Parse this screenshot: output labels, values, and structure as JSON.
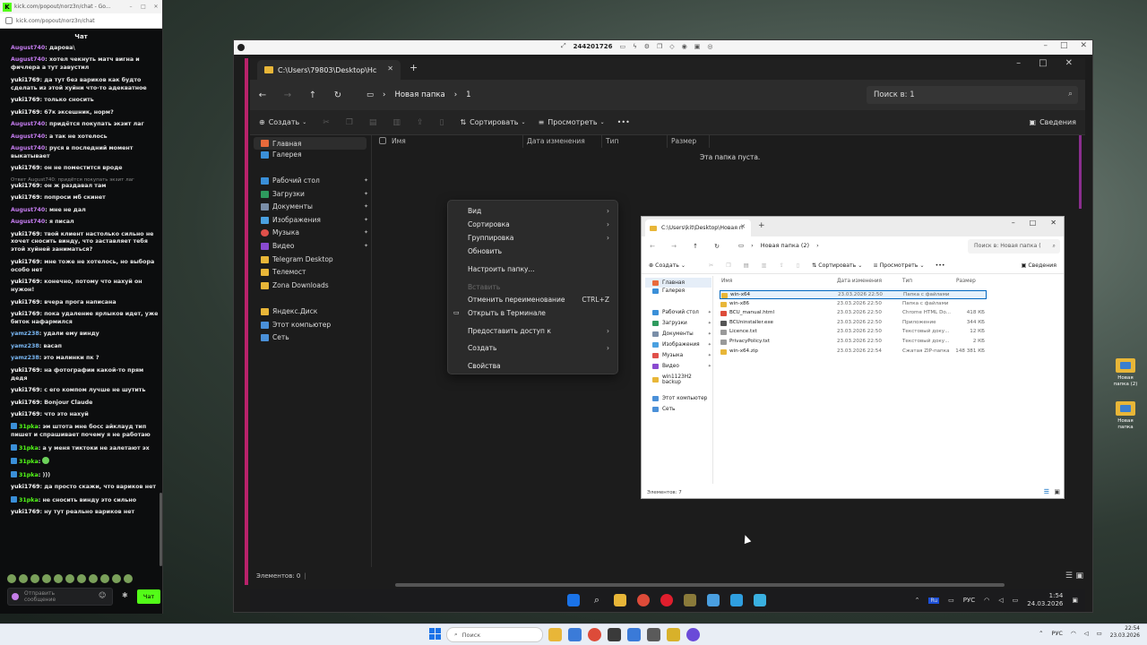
{
  "chat": {
    "window_url": "kick.com/popout/norz3n/chat - Go...",
    "address": "kick.com/popout/norz3n/chat",
    "title": "Чат",
    "messages": [
      {
        "user": "August740",
        "color": "#c77df3",
        "text": "дарова\\"
      },
      {
        "user": "August740",
        "color": "#c77df3",
        "text": "хотел чекнуть матч вигна и фичлера а тут завустил"
      },
      {
        "user": "yuki1769",
        "color": "#ffffff",
        "text": "да тут без вариков как будто сделать из этой хуйни что-то адекватное"
      },
      {
        "user": "yuki1769",
        "color": "#ffffff",
        "text": "только сносить"
      },
      {
        "user": "yuki1769",
        "color": "#ffffff",
        "text": "67к эксешник, норм?"
      },
      {
        "user": "August740",
        "color": "#c77df3",
        "text": "придётся покупать экзит лаг"
      },
      {
        "user": "August740",
        "color": "#c77df3",
        "text": "а так не хотелось"
      },
      {
        "user": "August740",
        "color": "#c77df3",
        "text": "руся в последний момент выкатывает"
      },
      {
        "user": "yuki1769",
        "color": "#ffffff",
        "text": "он не поместится вроде"
      },
      {
        "user": "yuki1769",
        "color": "#ffffff",
        "text": "он ж раздавал там",
        "reply": "Ответ August740: придётся покупать экзит лаг"
      },
      {
        "user": "yuki1769",
        "color": "#ffffff",
        "text": "попроси мб скинет"
      },
      {
        "user": "August740",
        "color": "#c77df3",
        "text": "мне не дал"
      },
      {
        "user": "August740",
        "color": "#c77df3",
        "text": "я писал"
      },
      {
        "user": "yuki1769",
        "color": "#ffffff",
        "text": "твой клиент настолько сильно не хочет сносить винду, что заставляет тебя этой хуйней заниматься?"
      },
      {
        "user": "yuki1769",
        "color": "#ffffff",
        "text": "мне тоже не хотелось, но выбора особо нет"
      },
      {
        "user": "yuki1769",
        "color": "#ffffff",
        "text": "конечно, потому что нахуй он нужон!"
      },
      {
        "user": "yuki1769",
        "color": "#ffffff",
        "text": "вчера прога написана"
      },
      {
        "user": "yuki1769",
        "color": "#ffffff",
        "text": "пока удаление ярлыков идет, уже биток нафармился"
      },
      {
        "user": "yamz238",
        "color": "#7ab8f5",
        "text": "удали ему винду"
      },
      {
        "user": "yamz238",
        "color": "#7ab8f5",
        "text": "васап"
      },
      {
        "user": "yamz238",
        "color": "#7ab8f5",
        "text": "это малинки пк ?"
      },
      {
        "user": "yuki1769",
        "color": "#ffffff",
        "text": "на фотографии какой-то прям дедя"
      },
      {
        "user": "yuki1769",
        "color": "#ffffff",
        "text": "с его компом лучше не шутить"
      },
      {
        "user": "yuki1769",
        "color": "#ffffff",
        "text": "Bonjour Claude"
      },
      {
        "user": "yuki1769",
        "color": "#ffffff",
        "text": "что это нахуй"
      },
      {
        "user": "31pka",
        "color": "#53fc18",
        "badge": true,
        "text": "эм штота мне босс айклауд тип пишет и спрашивает почему я не работаю"
      },
      {
        "user": "31pka",
        "color": "#53fc18",
        "badge": true,
        "text": "а у меня тиктоки не залетают эх"
      },
      {
        "user": "31pka",
        "color": "#53fc18",
        "badge": true,
        "emote": true,
        "text": ""
      },
      {
        "user": "31pka",
        "color": "#53fc18",
        "badge": true,
        "text": ")))"
      },
      {
        "user": "yuki1769",
        "color": "#ffffff",
        "text": "да просто скажи, что вариков нет"
      },
      {
        "user": "31pka",
        "color": "#53fc18",
        "badge": true,
        "text": "не сносить винду это сильно"
      },
      {
        "user": "yuki1769",
        "color": "#ffffff",
        "text": "ну тут реально вариков нет"
      }
    ],
    "input_placeholder": "Отправить сообщение",
    "send_label": "Чат"
  },
  "remote": {
    "session_id": "244201726",
    "tab_title": "C:\\Users\\79803\\Desktop\\Нс",
    "breadcrumb": [
      "Новая папка",
      "1"
    ],
    "search_placeholder": "Поиск в: 1",
    "cmd": {
      "create": "Создать",
      "sort": "Сортировать",
      "view": "Просмотреть",
      "details": "Сведения"
    },
    "sidebar": {
      "home": "Главная",
      "gallery": "Галерея",
      "desktop": "Рабочий стол",
      "downloads": "Загрузки",
      "documents": "Документы",
      "pictures": "Изображения",
      "music": "Музыка",
      "video": "Видео",
      "telegram": "Telegram Desktop",
      "telemost": "Телемост",
      "zona": "Zona Downloads",
      "yadisk": "Яндекс.Диск",
      "thispc": "Этот компьютер",
      "network": "Сеть"
    },
    "columns": {
      "name": "Имя",
      "date": "Дата изменения",
      "type": "Тип",
      "size": "Размер"
    },
    "empty_text": "Эта папка пуста.",
    "status": "Элементов: 0",
    "tray": {
      "lang": "РУС",
      "time": "1:54",
      "date": "24.03.2026"
    }
  },
  "context_menu": {
    "view": "Вид",
    "sort": "Сортировка",
    "group": "Группировка",
    "refresh": "Обновить",
    "customize": "Настроить папку...",
    "paste": "Вставить",
    "undo_rename": "Отменить переименование",
    "undo_shortcut": "CTRL+Z",
    "open_terminal": "Открыть в Терминале",
    "share": "Предоставить доступ к",
    "create": "Создать",
    "properties": "Свойства"
  },
  "explorer2": {
    "tab_title": "C:\\Users\\kit\\Desktop\\Новая п",
    "breadcrumb": [
      "Новая папка (2)"
    ],
    "search_placeholder": "Поиск в: Новая папка (",
    "cmd": {
      "create": "Создать",
      "sort": "Сортировать",
      "view": "Просмотреть",
      "details": "Сведения"
    },
    "sidebar": [
      "Главная",
      "Галерея",
      "Рабочий стол",
      "Загрузки",
      "Документы",
      "Изображения",
      "Музыка",
      "Видео",
      "win1123H2 backup",
      "Этот компьютер",
      "Сеть"
    ],
    "columns": {
      "name": "Имя",
      "date": "Дата изменения",
      "type": "Тип",
      "size": "Размер"
    },
    "files": [
      {
        "name": "win-x64",
        "date": "23.03.2026 22:50",
        "type": "Папка с файлами",
        "size": ""
      },
      {
        "name": "win-x86",
        "date": "23.03.2026 22:50",
        "type": "Папка с файлами",
        "size": ""
      },
      {
        "name": "BCU_manual.html",
        "date": "23.03.2026 22:50",
        "type": "Chrome HTML Do...",
        "size": "418 КБ"
      },
      {
        "name": "BCUninstaller.exe",
        "date": "23.03.2026 22:50",
        "type": "Приложение",
        "size": "344 КБ"
      },
      {
        "name": "Licence.txt",
        "date": "23.03.2026 22:50",
        "type": "Текстовый доку...",
        "size": "12 КБ"
      },
      {
        "name": "PrivacyPolicy.txt",
        "date": "23.03.2026 22:50",
        "type": "Текстовый доку...",
        "size": "2 КБ"
      },
      {
        "name": "win-x64.zip",
        "date": "23.03.2026 22:54",
        "type": "Сжатая ZIP-папка",
        "size": "148 381 КБ"
      }
    ],
    "status": "Элементов: 7"
  },
  "desktop_icons": [
    {
      "label": "Новая папка (2)"
    },
    {
      "label": "Новая папка"
    }
  ],
  "taskbar": {
    "search": "Поиск",
    "lang": "РУС",
    "time": "22:54",
    "date": "23.03.2026"
  }
}
